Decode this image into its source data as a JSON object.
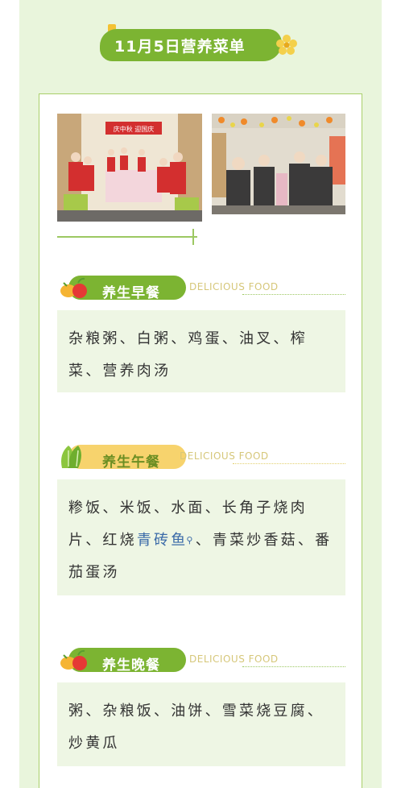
{
  "title": "11月5日营养菜单",
  "colors": {
    "accent_green": "#7cb432",
    "accent_yellow": "#f7d36d",
    "page_bg": "#e9f5dc",
    "box_bg": "#eef6e4"
  },
  "sections": [
    {
      "label": "养生早餐",
      "subtitle": "DELICIOUS FOOD",
      "icon": "fruit-icon",
      "items_text": "杂粮粥、白粥、鸡蛋、油叉、榨菜、营养肉汤"
    },
    {
      "label": "养生午餐",
      "subtitle": "DELICIOUS FOOD",
      "icon": "cabbage-icon",
      "items_before": "糁饭、米饭、水面、长角子烧肉片、红烧",
      "items_link": "青砖鱼",
      "items_after": "、青菜炒香菇、番茄蛋汤"
    },
    {
      "label": "养生晚餐",
      "subtitle": "DELICIOUS FOOD",
      "icon": "fruit-icon",
      "items_text": "粥、杂粮饭、油饼、雪菜烧豆腐、炒黄瓜"
    }
  ],
  "banner_photo_text": "庆中秋 迎国庆"
}
